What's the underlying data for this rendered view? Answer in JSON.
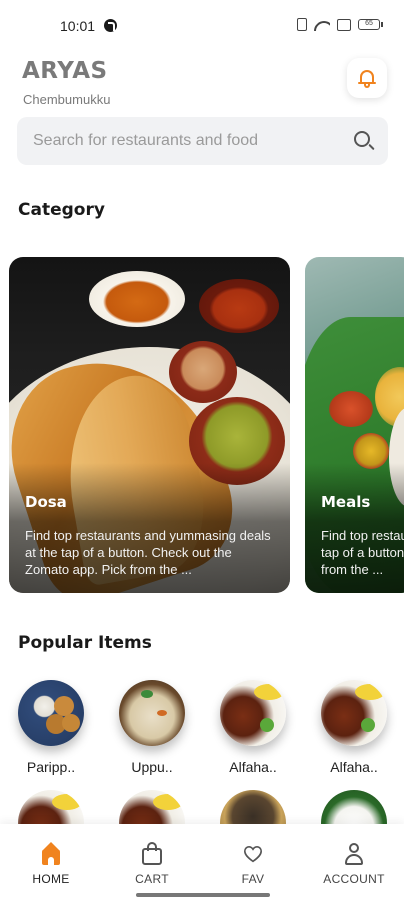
{
  "status_bar": {
    "time": "10:01",
    "battery": "65"
  },
  "header": {
    "brand": "ARYAS",
    "location": "Chembumukku",
    "accent_color": "#f0831e"
  },
  "search": {
    "placeholder": "Search for restaurants and food"
  },
  "category": {
    "title": "Category",
    "cards": [
      {
        "name": "Dosa",
        "description": "Find top restaurants and yummasing deals at the tap of a button. Check out the Zomato app. Pick from the ..."
      },
      {
        "name": "Meals",
        "description": "Find top restaurants and yummasing deals at the tap of a button. Check out the Zomato app. Pick from the ..."
      }
    ]
  },
  "popular": {
    "title": "Popular Items",
    "items": [
      {
        "label": "Paripp.."
      },
      {
        "label": "Uppu.."
      },
      {
        "label": "Alfaha.."
      },
      {
        "label": "Alfaha.."
      }
    ]
  },
  "bottom_nav": {
    "items": [
      {
        "label": "HOME",
        "icon": "home-icon",
        "active": true
      },
      {
        "label": "CART",
        "icon": "bag-icon"
      },
      {
        "label": "FAV",
        "icon": "heart-icon"
      },
      {
        "label": "ACCOUNT",
        "icon": "account-icon"
      }
    ]
  }
}
